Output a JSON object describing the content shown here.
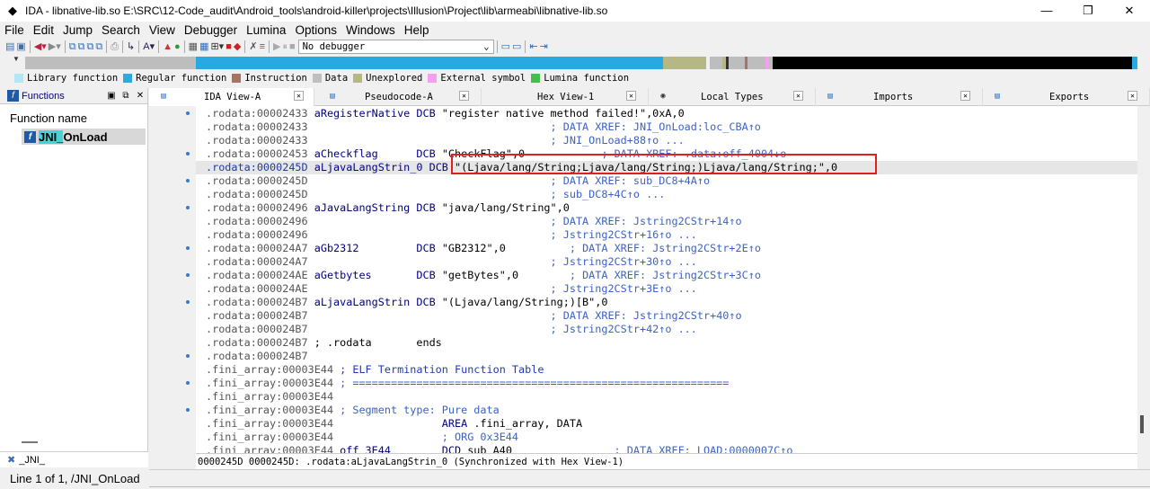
{
  "window": {
    "title": "IDA - libnative-lib.so E:\\SRC\\12-Code_audit\\Android_tools\\android-killer\\projects\\Illusion\\Project\\lib\\armeabi\\libnative-lib.so",
    "minimize": "—",
    "maximize": "❐",
    "close": "✕"
  },
  "menu": [
    "File",
    "Edit",
    "Jump",
    "Search",
    "View",
    "Debugger",
    "Lumina",
    "Options",
    "Windows",
    "Help"
  ],
  "toolbar": {
    "debugger_select": "No debugger"
  },
  "legend": [
    {
      "label": "Library function",
      "color": "#b3e7f5"
    },
    {
      "label": "Regular function",
      "color": "#2ea8e0"
    },
    {
      "label": "Instruction",
      "color": "#a67462"
    },
    {
      "label": "Data",
      "color": "#bfbfbf"
    },
    {
      "label": "Unexplored",
      "color": "#b5b885"
    },
    {
      "label": "External symbol",
      "color": "#f59ff0"
    },
    {
      "label": "Lumina function",
      "color": "#3ec24b"
    }
  ],
  "functions_pane": {
    "title": "Functions",
    "column": "Function name",
    "items": [
      {
        "name_hl": "JNI_",
        "name_rest": "OnLoad"
      }
    ],
    "filter": "_JNI_",
    "status": "Line 1 of 1, /JNI_OnLoad"
  },
  "tabs": [
    {
      "label": "IDA View-A",
      "icon": "ida-view-icon",
      "active": true
    },
    {
      "label": "Pseudocode-A",
      "icon": "pseudocode-icon",
      "active": false
    },
    {
      "label": "Hex View-1",
      "icon": "hex-view-icon",
      "active": false
    },
    {
      "label": "Local Types",
      "icon": "local-types-icon",
      "active": false
    },
    {
      "label": "Imports",
      "icon": "imports-icon",
      "active": false
    },
    {
      "label": "Exports",
      "icon": "exports-icon",
      "active": false
    }
  ],
  "code_lines": [
    {
      "addr": ".rodata:00002433",
      "label": "aRegisterNative",
      "op": " DCB ",
      "text": "\"register native method failed!\",0xA,0",
      "comment": "",
      "dot": true
    },
    {
      "addr": ".rodata:00002433",
      "label": "",
      "op": "",
      "text": "",
      "comment": "                                      ; DATA XREF: JNI_OnLoad:loc_CBA↑o",
      "dot": false
    },
    {
      "addr": ".rodata:00002433",
      "label": "",
      "op": "",
      "text": "",
      "comment": "                                      ; JNI_OnLoad+88↑o ...",
      "dot": false
    },
    {
      "addr": ".rodata:00002453",
      "label": "aCheckflag",
      "op": "      DCB ",
      "text": "\"CheckFlag\",0",
      "comment": "            ; DATA XREF: .data:off_4004↓o",
      "dot": true
    },
    {
      "addr": ".rodata:0000245D",
      "label": "aLjavaLangStrin_0",
      "op": " DCB ",
      "text": "\"(Ljava/lang/String;Ljava/lang/String;)Ljava/lang/String;\",0",
      "comment": "",
      "dot": false,
      "selected": true
    },
    {
      "addr": ".rodata:0000245D",
      "label": "",
      "op": "",
      "text": "",
      "comment": "                                      ; DATA XREF: sub_DC8+4A↑o",
      "dot": true
    },
    {
      "addr": ".rodata:0000245D",
      "label": "",
      "op": "",
      "text": "",
      "comment": "                                      ; sub_DC8+4C↑o ...",
      "dot": false
    },
    {
      "addr": ".rodata:00002496",
      "label": "aJavaLangString",
      "op": " DCB ",
      "text": "\"java/lang/String\",0",
      "comment": "",
      "dot": true
    },
    {
      "addr": ".rodata:00002496",
      "label": "",
      "op": "",
      "text": "",
      "comment": "                                      ; DATA XREF: Jstring2CStr+14↑o",
      "dot": false
    },
    {
      "addr": ".rodata:00002496",
      "label": "",
      "op": "",
      "text": "",
      "comment": "                                      ; Jstring2CStr+16↑o ...",
      "dot": false
    },
    {
      "addr": ".rodata:000024A7",
      "label": "aGb2312",
      "op": "         DCB ",
      "text": "\"GB2312\",0",
      "comment": "          ; DATA XREF: Jstring2CStr+2E↑o",
      "dot": true
    },
    {
      "addr": ".rodata:000024A7",
      "label": "",
      "op": "",
      "text": "",
      "comment": "                                      ; Jstring2CStr+30↑o ...",
      "dot": false
    },
    {
      "addr": ".rodata:000024AE",
      "label": "aGetbytes",
      "op": "       DCB ",
      "text": "\"getBytes\",0",
      "comment": "        ; DATA XREF: Jstring2CStr+3C↑o",
      "dot": true
    },
    {
      "addr": ".rodata:000024AE",
      "label": "",
      "op": "",
      "text": "",
      "comment": "                                      ; Jstring2CStr+3E↑o ...",
      "dot": false
    },
    {
      "addr": ".rodata:000024B7",
      "label": "aLjavaLangStrin",
      "op": " DCB ",
      "text": "\"(Ljava/lang/String;)[B\",0",
      "comment": "",
      "dot": true
    },
    {
      "addr": ".rodata:000024B7",
      "label": "",
      "op": "",
      "text": "",
      "comment": "                                      ; DATA XREF: Jstring2CStr+40↑o",
      "dot": false
    },
    {
      "addr": ".rodata:000024B7",
      "label": "",
      "op": "",
      "text": "",
      "comment": "                                      ; Jstring2CStr+42↑o ...",
      "dot": false
    },
    {
      "addr": ".rodata:000024B7",
      "label": "",
      "op": "",
      "text": " ; .rodata       ends",
      "comment": "",
      "dot": false
    },
    {
      "addr": ".rodata:000024B7",
      "label": "",
      "op": "",
      "text": "",
      "comment": "",
      "dot": true
    },
    {
      "addr": ".fini_array:00003E44",
      "label": "",
      "op": "",
      "text": "",
      "comment": " ; ELF Termination Function Table",
      "dot": false,
      "blueComment": true
    },
    {
      "addr": ".fini_array:00003E44",
      "label": "",
      "op": "",
      "text": "",
      "comment": " ; ===========================================================",
      "dot": true
    },
    {
      "addr": ".fini_array:00003E44",
      "label": "",
      "op": "",
      "text": "",
      "comment": "",
      "dot": false
    },
    {
      "addr": ".fini_array:00003E44",
      "label": "",
      "op": "",
      "text": "",
      "comment": " ; Segment type: Pure data",
      "dot": true
    },
    {
      "addr": ".fini_array:00003E44",
      "label": "",
      "op": "                 AREA ",
      "text": ".fini_array, DATA",
      "comment": "",
      "dot": false
    },
    {
      "addr": ".fini_array:00003E44",
      "label": "",
      "op": "",
      "text": "",
      "comment": "                 ; ORG 0x3E44",
      "dot": false
    },
    {
      "addr": ".fini_array:00003E44",
      "label": "off_3E44",
      "op": "        DCD ",
      "text": "sub_A40",
      "comment": "                ; DATA XREF: LOAD:0000007C↑o",
      "dot": false
    }
  ],
  "code_status": "0000245D 0000245D: .rodata:aLjavaLangStrin_0 (Synchronized with Hex View-1)"
}
